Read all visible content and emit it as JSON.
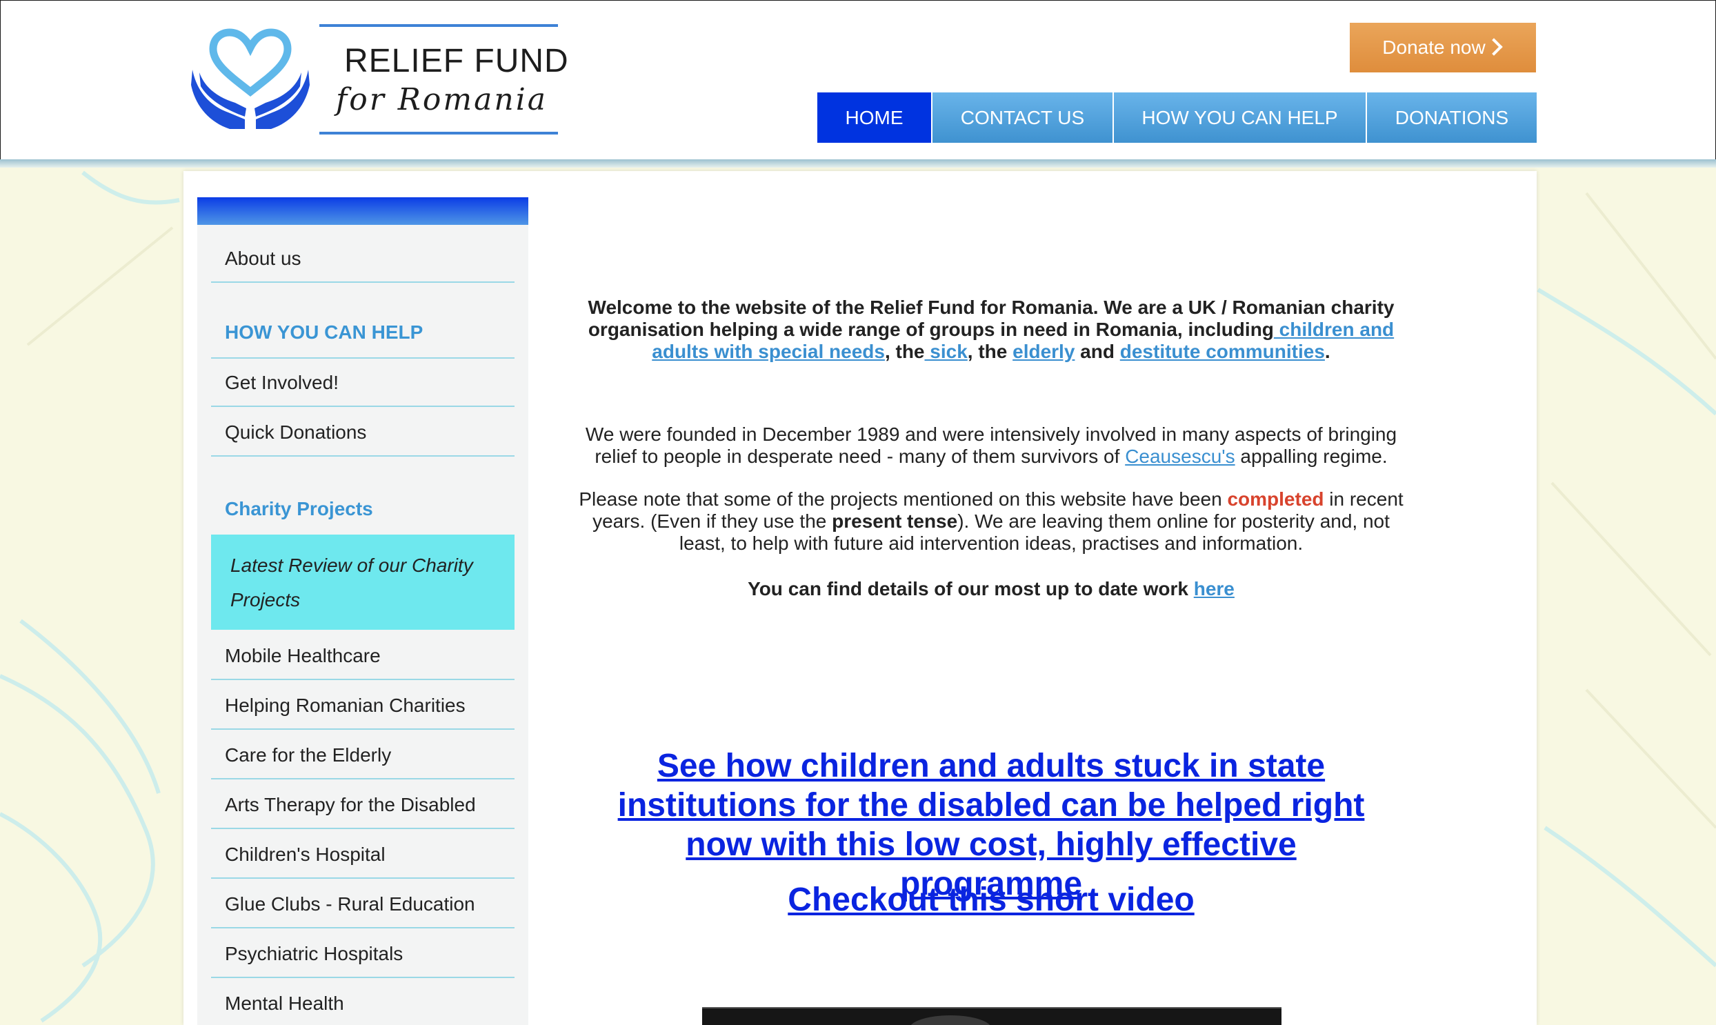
{
  "header": {
    "logo_line1": "RELIEF FUND",
    "logo_line2": "for Romania",
    "donate_label": "Donate now",
    "nav": [
      {
        "label": "HOME",
        "active": true
      },
      {
        "label": "CONTACT US",
        "active": false
      },
      {
        "label": "HOW YOU CAN HELP",
        "active": false
      },
      {
        "label": "DONATIONS",
        "active": false
      }
    ]
  },
  "sidebar": {
    "about": "About us",
    "help_heading": "HOW YOU CAN HELP",
    "help_items": [
      "Get Involved!",
      "Quick Donations"
    ],
    "projects_heading": "Charity Projects",
    "highlight": "Latest Review of our Charity Projects",
    "project_items": [
      "Mobile Healthcare",
      "Helping Romanian Charities",
      "Care for the Elderly",
      "Arts Therapy for the Disabled",
      "Children's Hospital",
      "Glue Clubs - Rural Education",
      "Psychiatric Hospitals",
      "Mental Health"
    ]
  },
  "content": {
    "intro": {
      "text1": "Welcome to the website of the Relief Fund for Romania. We are a UK / Romanian charity organisation helping a wide range of groups in need in Romania, including",
      "link_children": " children and adults with special needs",
      "text2": ", the",
      "link_sick": " sick",
      "text3": ", the ",
      "link_elderly": "elderly",
      "text4": " and ",
      "link_destitute": "destitute communities",
      "text5": "."
    },
    "founded": {
      "text1": "We were founded in December 1989 and were intensively involved in many aspects of bringing relief to people in desperate need - many of them survivors of ",
      "link_ceausescu": "Ceausescu's",
      "text2": " appalling regime."
    },
    "note": {
      "text1": "Please note that some of the projects mentioned on this website have been ",
      "completed": "completed",
      "text2": " in recent years. (Even if they use the ",
      "present_tense": "present tense",
      "text3": "). We are leaving them online for posterity and, not least, to help with future aid intervention ideas, practises and information."
    },
    "details": {
      "text": "You can find details of our most up to date work ",
      "link_here": "here"
    },
    "big_link": "See how children and adults stuck in state institutions for the disabled can be helped right now with this low cost, highly effective programme",
    "video_link": "Checkout this short video"
  },
  "colors": {
    "nav_active": "#0033e0",
    "nav_bg": "#4fa2dc",
    "donate_bg": "#e6994a",
    "link": "#3a8fd0",
    "big_link": "#0a24e0",
    "highlight_bg": "#6ee8ee",
    "heading": "#3a95d4",
    "completed": "#d8432d"
  },
  "icons": {
    "logo": "heart-in-hands-icon",
    "donate_chevron": "chevron-right-icon"
  }
}
